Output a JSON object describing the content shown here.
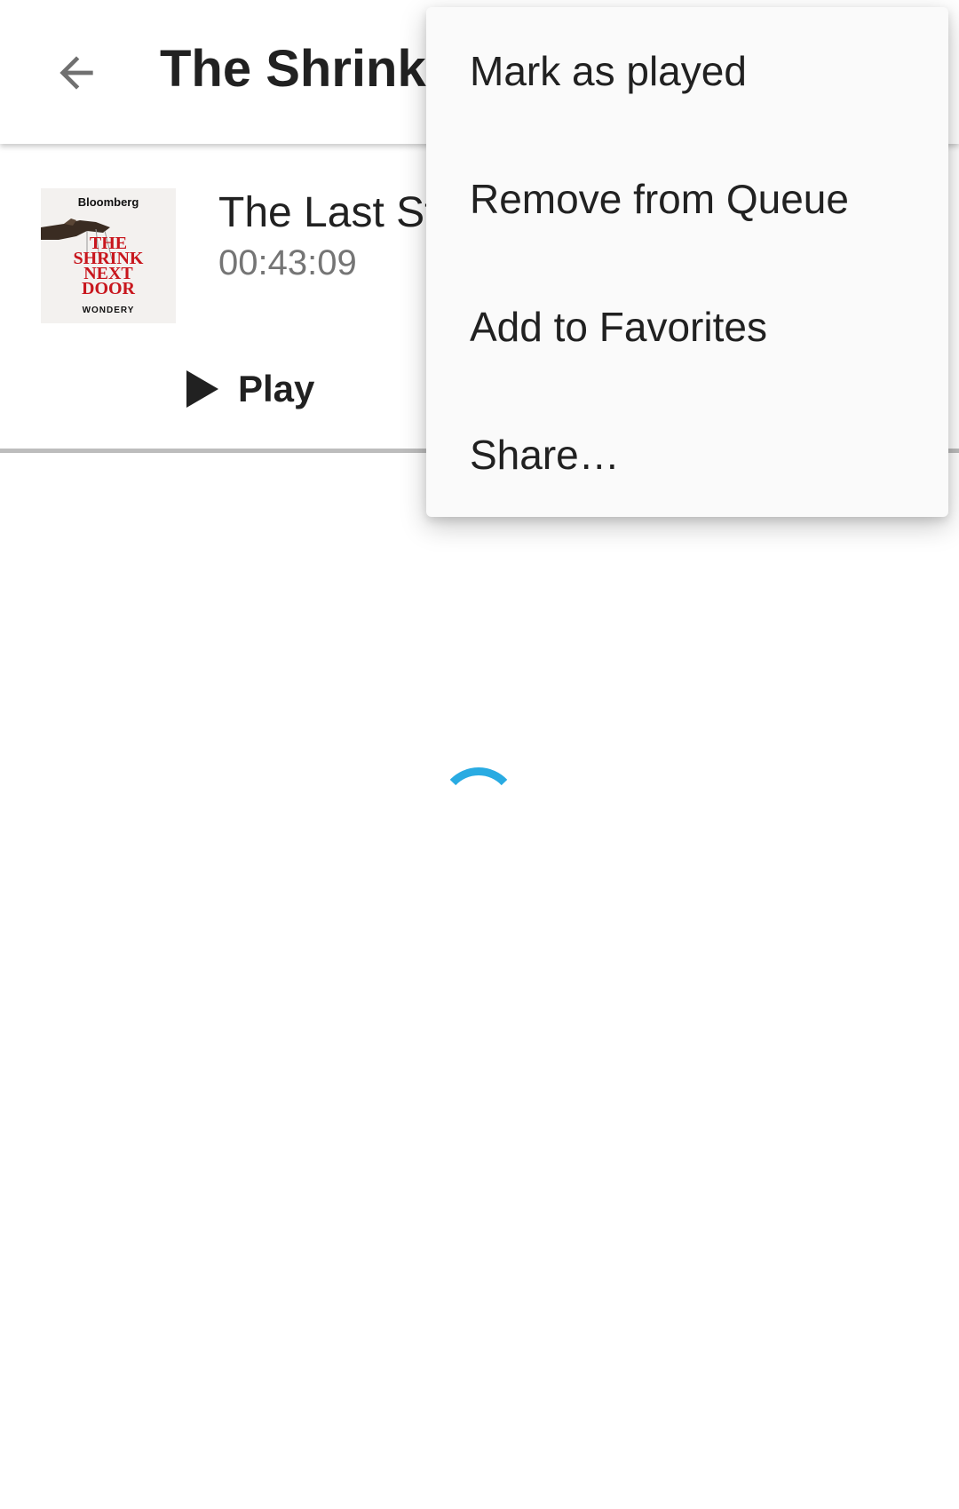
{
  "appbar": {
    "title": "The Shrink",
    "back_icon": "arrow-back-icon"
  },
  "episode": {
    "cover": {
      "brand": "Bloomberg",
      "show_line1": "THE",
      "show_line2": "SHRINK",
      "show_line3": "NEXT",
      "show_line4": "DOOR",
      "publisher": "WONDERY"
    },
    "title": "The Last St",
    "duration": "00:43:09",
    "play_label": "Play"
  },
  "menu": {
    "items": [
      {
        "label": "Mark as played"
      },
      {
        "label": "Remove from Queue"
      },
      {
        "label": "Add to Favorites"
      },
      {
        "label": "Share…"
      }
    ]
  },
  "colors": {
    "spinner": "#29abe2",
    "show_title_red": "#c8161d"
  }
}
